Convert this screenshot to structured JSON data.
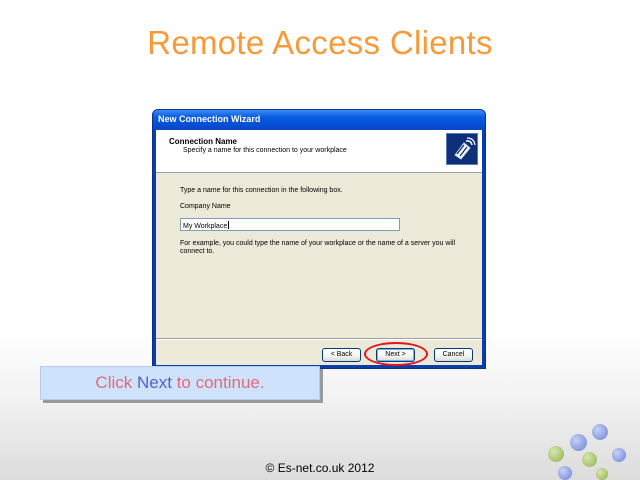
{
  "slide": {
    "title": "Remote Access Clients",
    "caption_prefix": "Click ",
    "caption_keyword": "Next",
    "caption_suffix": " to continue.",
    "footer": "© Es-net.co.uk 2012"
  },
  "wizard": {
    "window_title": "New Connection Wizard",
    "header_title": "Connection Name",
    "header_subtitle": "Specify a name for this connection to your workplace",
    "instruction": "Type a name for this connection in the following box.",
    "field_label": "Company Name",
    "field_value": "My Workplace",
    "example_text": "For example, you could type the name of your workplace or the name of a server you will connect to.",
    "buttons": {
      "back": "< Back",
      "next": "Next >",
      "cancel": "Cancel"
    },
    "header_icon": "phone-connection-icon"
  },
  "colors": {
    "title": "#f79a3a",
    "caption_text": "#e36a78",
    "caption_keyword": "#5560cc",
    "caption_bg": "#cfe2fb",
    "highlight": "#e0141e",
    "titlebar": "#0a5be0"
  }
}
